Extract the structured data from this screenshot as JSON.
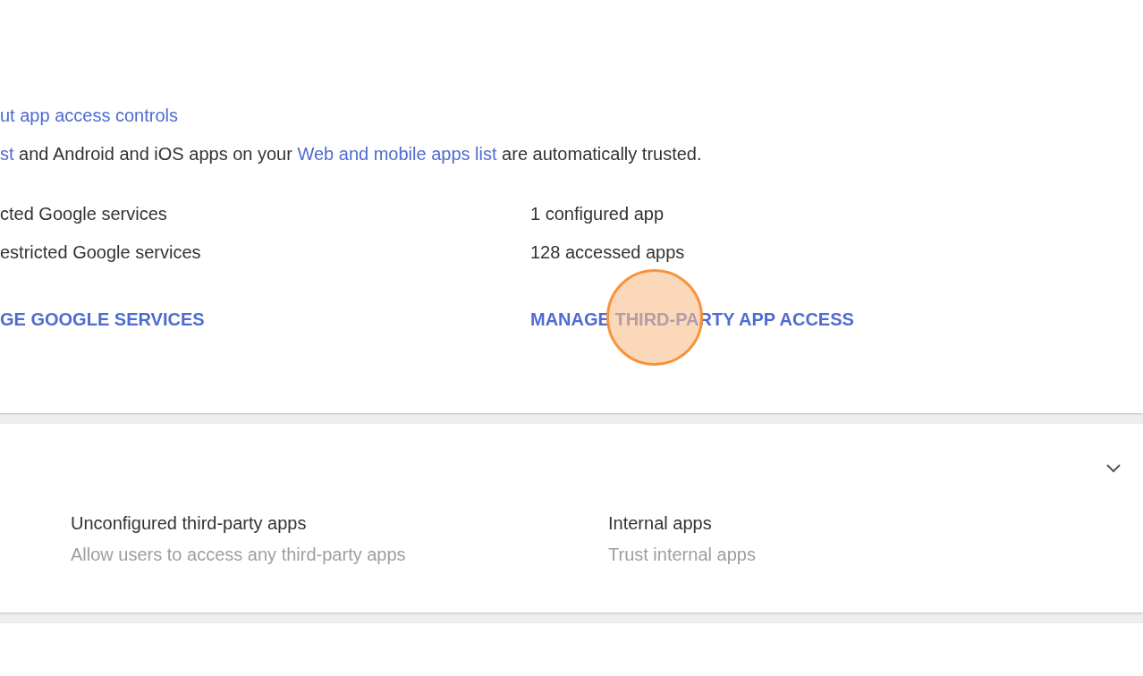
{
  "access_card": {
    "learn_link": "ut app access controls",
    "trust_note": [
      {
        "kind": "link",
        "text": "st"
      },
      {
        "kind": "text",
        "text": " and Android and iOS apps on your "
      },
      {
        "kind": "link",
        "text": "Web and mobile apps list"
      },
      {
        "kind": "text",
        "text": " are automatically trusted."
      }
    ],
    "columns": [
      {
        "lines": [
          "cted Google services",
          "estricted Google services"
        ],
        "action": "GE GOOGLE SERVICES"
      },
      {
        "lines": [
          "1 configured app",
          "128 accessed apps"
        ],
        "action": "MANAGE THIRD-PARTY APP ACCESS"
      }
    ]
  },
  "settings_card": {
    "expanded": false,
    "items": [
      {
        "title": "Unconfigured third-party apps",
        "subtitle": "Allow users to access any third-party apps"
      },
      {
        "title": "Internal apps",
        "subtitle": "Trust internal apps"
      }
    ]
  }
}
